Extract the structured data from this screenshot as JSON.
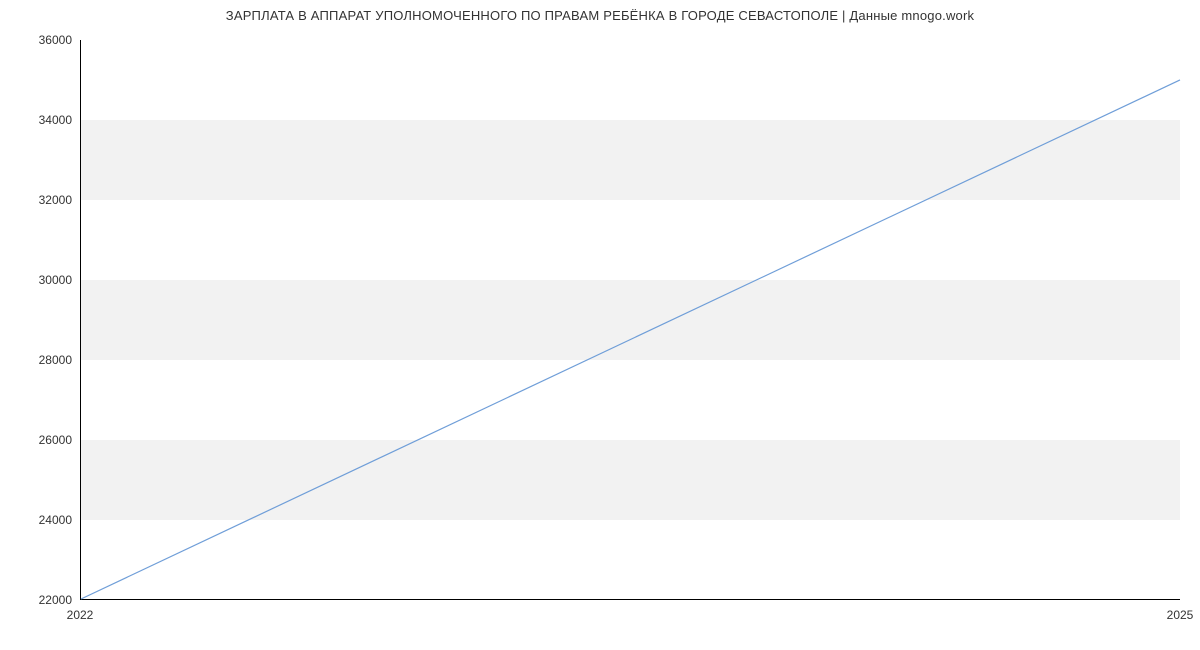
{
  "chart_data": {
    "type": "line",
    "title": "ЗАРПЛАТА В АППАРАТ УПОЛНОМОЧЕННОГО ПО ПРАВАМ РЕБЁНКА В ГОРОДЕ СЕВАСТОПОЛЕ | Данные mnogo.work",
    "xlabel": "",
    "ylabel": "",
    "x": [
      2022,
      2025
    ],
    "values": [
      22000,
      35000
    ],
    "x_ticks": [
      2022,
      2025
    ],
    "y_ticks": [
      22000,
      24000,
      26000,
      28000,
      30000,
      32000,
      34000,
      36000
    ],
    "xlim": [
      2022,
      2025
    ],
    "ylim": [
      22000,
      36000
    ],
    "bands": [
      [
        24000,
        26000
      ],
      [
        28000,
        30000
      ],
      [
        32000,
        34000
      ]
    ],
    "line_color": "#6f9ed8"
  }
}
